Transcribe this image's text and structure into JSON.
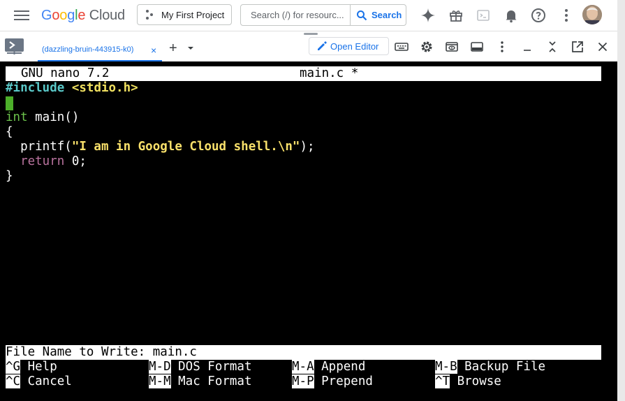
{
  "header": {
    "logo_google": "Google",
    "logo_cloud": "Cloud",
    "project_label": "My First Project",
    "search_placeholder": "Search (/) for resourc...",
    "search_button": "Search"
  },
  "shell": {
    "tab_label": "(dazzling-bruin-443915-k0)",
    "tab_close": "×",
    "add_tab": "+",
    "open_editor": "Open Editor"
  },
  "nano": {
    "version": "GNU nano 7.2",
    "filename": "main.c *",
    "code": {
      "line1_directive": "#include",
      "line1_header": "<stdio.h>",
      "line3_type": "int",
      "line3_rest": " main()",
      "line4": "{",
      "line5_call": "  printf(",
      "line5_string": "\"I am in Google Cloud shell.\\n\"",
      "line5_end": ");",
      "line6_keyword": "return",
      "line6_rest": " 0;",
      "line7": "}"
    },
    "prompt_value": "File Name to Write: main.c",
    "shortcuts": [
      {
        "key": "^G",
        "label": " Help"
      },
      {
        "key": "M-D",
        "label": " DOS Format"
      },
      {
        "key": "M-A",
        "label": " Append"
      },
      {
        "key": "M-B",
        "label": " Backup File"
      },
      {
        "key": "^C",
        "label": " Cancel"
      },
      {
        "key": "M-M",
        "label": " Mac Format"
      },
      {
        "key": "M-P",
        "label": " Prepend"
      },
      {
        "key": "^T",
        "label": " Browse"
      }
    ]
  },
  "colors": {
    "accent": "#1a73e8",
    "terminal_bg": "#000000",
    "cursor": "#4caf2a",
    "string": "#f8e06a",
    "keyword": "#6bc24b",
    "preprocessor": "#5ac8c8"
  }
}
